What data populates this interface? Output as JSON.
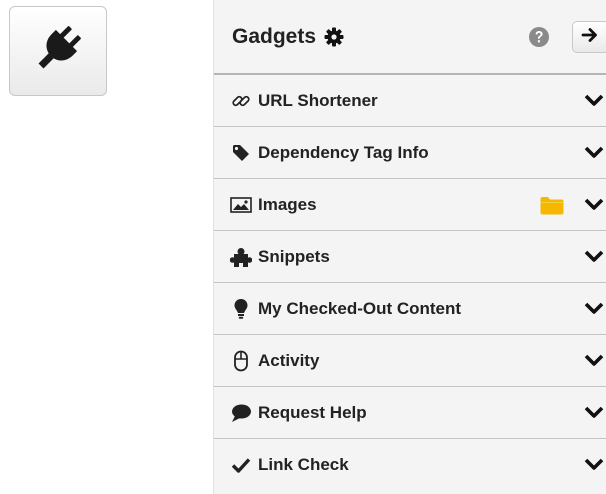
{
  "header": {
    "title": "Gadgets",
    "settings_icon": "gear-icon",
    "help_icon": "question-circle-icon",
    "collapse_icon": "arrow-right-icon"
  },
  "launcher": {
    "icon": "plug-icon"
  },
  "gadgets": [
    {
      "label": "URL Shortener",
      "icon": "link-icon"
    },
    {
      "label": "Dependency Tag Info",
      "icon": "tag-icon"
    },
    {
      "label": "Images",
      "icon": "image-icon",
      "extra_icon": "folder-icon"
    },
    {
      "label": "Snippets",
      "icon": "puzzle-icon"
    },
    {
      "label": "My Checked-Out Content",
      "icon": "lightbulb-icon"
    },
    {
      "label": "Activity",
      "icon": "mouse-icon"
    },
    {
      "label": "Request Help",
      "icon": "speech-bubble-icon"
    },
    {
      "label": "Link Check",
      "icon": "checkmark-icon"
    }
  ],
  "colors": {
    "folder": "#f5b800",
    "panel_bg": "#f4f4f4",
    "divider": "#c4c4c4"
  }
}
